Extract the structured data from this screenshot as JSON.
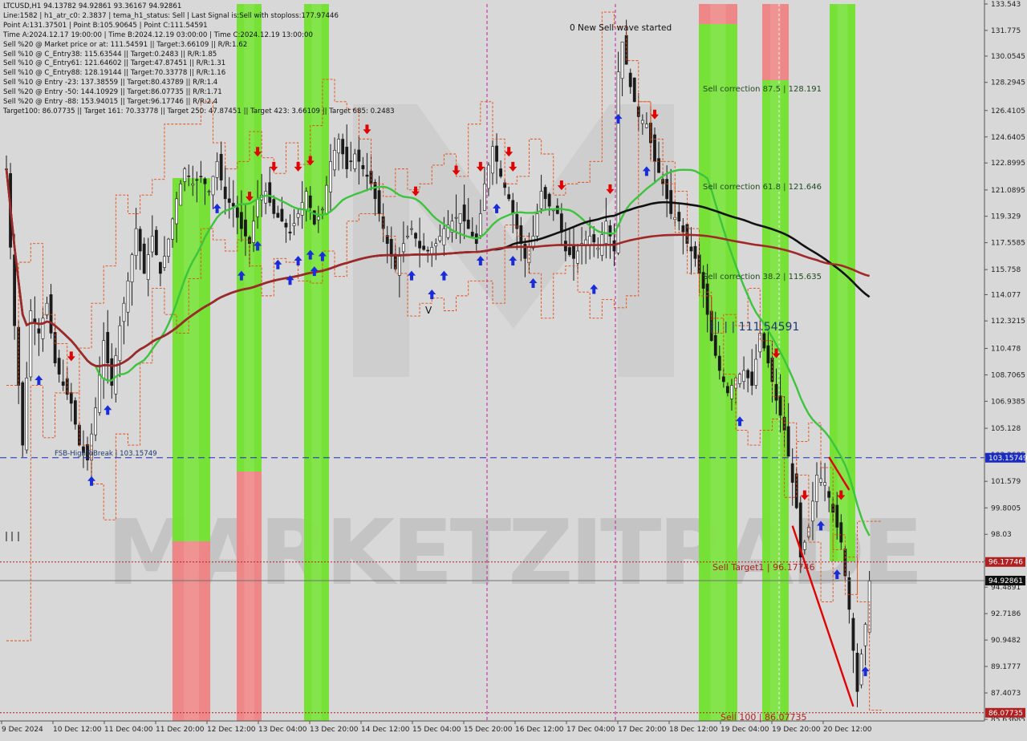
{
  "window": {
    "symbol_line": "LTCUSD,H1  94.13782 94.92861 93.36167 94.92861"
  },
  "info_lines": [
    "Line:1582 | h1_atr_c0: 2.3837 | tema_h1_status: Sell | Last Signal is:Sell with stoploss:177.97446",
    "Point A:131.37501 | Point B:105.90645 | Point C:111.54591",
    "Time A:2024.12.17 19:00:00 | Time B:2024.12.19 03:00:00 | Time C:2024.12.19 13:00:00",
    "Sell %20 @ Market price or at: 111.54591 || Target:3.66109 || R/R:1.62",
    "Sell %10 @ C_Entry38: 115.63544 || Target:0.2483 || R/R:1.85",
    "Sell %10 @ C_Entry61: 121.64602 || Target:47.87451 || R/R:1.31",
    "Sell %10 @ C_Entry88: 128.19144 || Target:70.33778 || R/R:1.16",
    "Sell %10 @ Entry -23: 137.38559 || Target:80.43789 || R/R:1.4",
    "Sell %20 @ Entry -50: 144.10929 || Target:86.07735 || R/R:1.71",
    "Sell %20 @ Entry -88: 153.94015 || Target:96.17746 || R/R:2.4",
    "Target100: 86.07735 || Target 161: 70.33778 || Target 250: 47.87451 || Target 423: 3.66109 || Target 685: 0.2483"
  ],
  "chart_data": {
    "type": "candlestick",
    "symbol": "LTCUSD",
    "timeframe": "H1",
    "ohlc_last": {
      "open": 94.13782,
      "high": 94.92861,
      "low": 93.36167,
      "close": 94.92861
    },
    "ylim": [
      85.63685,
      133.543
    ],
    "y_ticks": [
      133.543,
      131.775,
      130.0545,
      128.2945,
      126.4105,
      124.6405,
      122.8995,
      121.0895,
      119.329,
      117.5585,
      115.758,
      114.077,
      112.3215,
      110.478,
      108.7065,
      106.9385,
      105.128,
      103.3685,
      101.579,
      99.8005,
      98.03,
      96.2585,
      94.4891,
      92.7186,
      90.9482,
      89.1777,
      87.4073,
      85.63685
    ],
    "x_ticks": [
      "9 Dec 2024",
      "10 Dec 12:00",
      "11 Dec 04:00",
      "11 Dec 20:00",
      "12 Dec 12:00",
      "13 Dec 04:00",
      "13 Dec 20:00",
      "14 Dec 12:00",
      "15 Dec 04:00",
      "15 Dec 20:00",
      "16 Dec 12:00",
      "17 Dec 04:00",
      "17 Dec 20:00",
      "18 Dec 12:00",
      "19 Dec 04:00",
      "19 Dec 20:00",
      "20 Dec 12:00"
    ],
    "price_labels": [
      {
        "text": "103.15749",
        "value": 103.15749,
        "bg": "#1a2bbf"
      },
      {
        "text": "96.17746",
        "value": 96.17746,
        "bg": "#b02020"
      },
      {
        "text": "94.92861",
        "value": 94.92861,
        "bg": "#101010"
      },
      {
        "text": "86.07735",
        "value": 86.07735,
        "bg": "#b02020"
      }
    ],
    "annotations": [
      {
        "text": "0 New Sell wave started",
        "color": "#111111"
      },
      {
        "text": "Sell correction 87.5 | 128.191",
        "color": "#1e4a1e"
      },
      {
        "text": "Sell correction 61.8 | 121.646",
        "color": "#1e4a1e"
      },
      {
        "text": "Sell correction 38.2 | 115.635",
        "color": "#1e4a1e"
      },
      {
        "text": "| | | | 111.54591",
        "color": "#1e3a6e"
      },
      {
        "text": "FSB-HighToBreak | 103.15749",
        "color": "#1e3a6e"
      },
      {
        "text": "Sell Target1 | 96.17746",
        "color": "#b02020"
      },
      {
        "text": "Sell 100 | 86.07735",
        "color": "#b02020"
      },
      {
        "text": "V",
        "color": "#111111"
      }
    ],
    "key_levels": [
      {
        "name": "FSB-HighToBreak",
        "value": 103.15749,
        "color": "#1a2bbf",
        "style": "dash"
      },
      {
        "name": "Sell Target1",
        "value": 96.17746,
        "color": "#b02020",
        "style": "dot"
      },
      {
        "name": "Sell 100",
        "value": 86.07735,
        "color": "#b02020",
        "style": "dot"
      },
      {
        "name": "Current",
        "value": 94.92861,
        "color": "#707070",
        "style": "solid"
      }
    ],
    "colors": {
      "background": "#d8d8d8",
      "green_band": "#6fe22a",
      "red_band": "#f08080",
      "ma_black": "#111111",
      "ma_red": "#a02828",
      "ma_green": "#3cc43c",
      "envelope": "#e24a10",
      "buy_arrow": "#1a2bd8",
      "sell_arrow": "#e00000",
      "watermark": "MARKETZITRADE"
    }
  }
}
